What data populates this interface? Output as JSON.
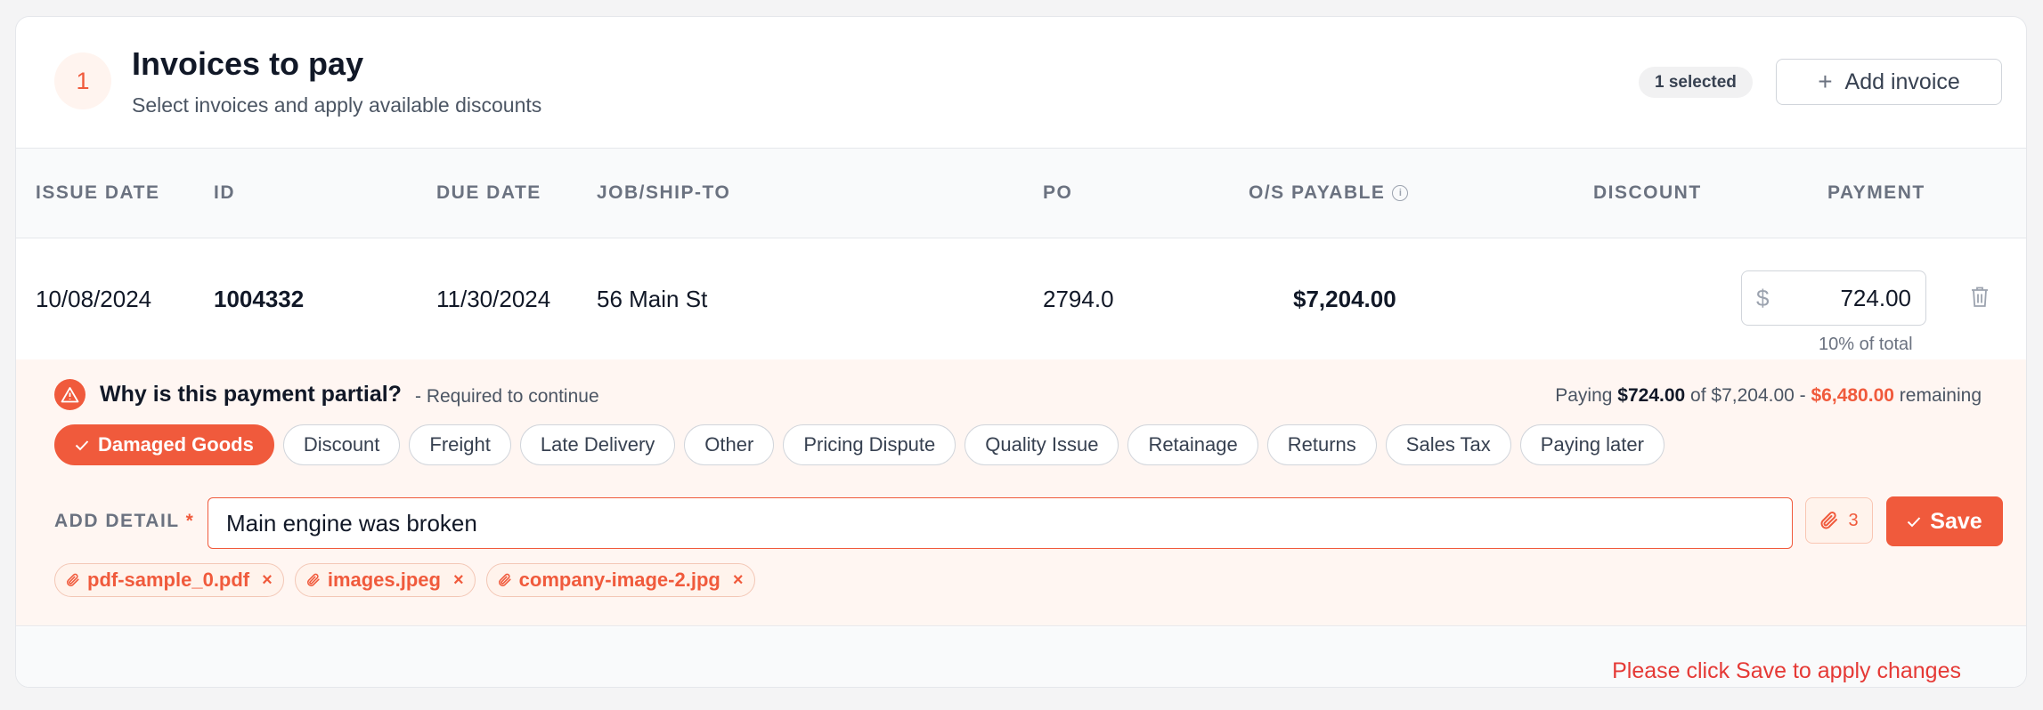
{
  "header": {
    "step": "1",
    "title": "Invoices to pay",
    "subtitle": "Select invoices and apply available discounts",
    "selected_count": "1 selected",
    "add_invoice_label": "Add invoice"
  },
  "table": {
    "columns": [
      "ISSUE DATE",
      "ID",
      "DUE DATE",
      "JOB/SHIP-TO",
      "PO",
      "O/S PAYABLE",
      "DISCOUNT",
      "PAYMENT"
    ],
    "row": {
      "issue_date": "10/08/2024",
      "id": "1004332",
      "due_date": "11/30/2024",
      "job_ship_to": "56 Main St",
      "po": "2794.0",
      "os_payable": "$7,204.00",
      "discount": "",
      "payment_currency": "$",
      "payment_value": "724.00",
      "payment_pct": "10% of total"
    }
  },
  "partial": {
    "question": "Why is this payment partial?",
    "required_note": "- Required to continue",
    "summary_paying_prefix": "Paying",
    "summary_paying_amount": "$724.00",
    "summary_of": "of $7,204.00 -",
    "summary_remaining_amount": "$6,480.00",
    "summary_remaining_suffix": "remaining",
    "reasons": [
      {
        "label": "Damaged Goods",
        "selected": true
      },
      {
        "label": "Discount",
        "selected": false
      },
      {
        "label": "Freight",
        "selected": false
      },
      {
        "label": "Late Delivery",
        "selected": false
      },
      {
        "label": "Other",
        "selected": false
      },
      {
        "label": "Pricing Dispute",
        "selected": false
      },
      {
        "label": "Quality Issue",
        "selected": false
      },
      {
        "label": "Retainage",
        "selected": false
      },
      {
        "label": "Returns",
        "selected": false
      },
      {
        "label": "Sales Tax",
        "selected": false
      },
      {
        "label": "Paying later",
        "selected": false
      }
    ],
    "detail_label": "ADD DETAIL",
    "detail_required_mark": "*",
    "detail_value": "Main engine was broken",
    "attachment_count": "3",
    "save_label": "Save",
    "attachments": [
      "pdf-sample_0.pdf",
      "images.jpeg",
      "company-image-2.jpg"
    ],
    "remove_glyph": "×"
  },
  "footer": {
    "message": "Please click Save to apply changes"
  },
  "colors": {
    "accent": "#f05a3c",
    "error_text": "#e53935",
    "panel_bg": "#fff6f2"
  }
}
